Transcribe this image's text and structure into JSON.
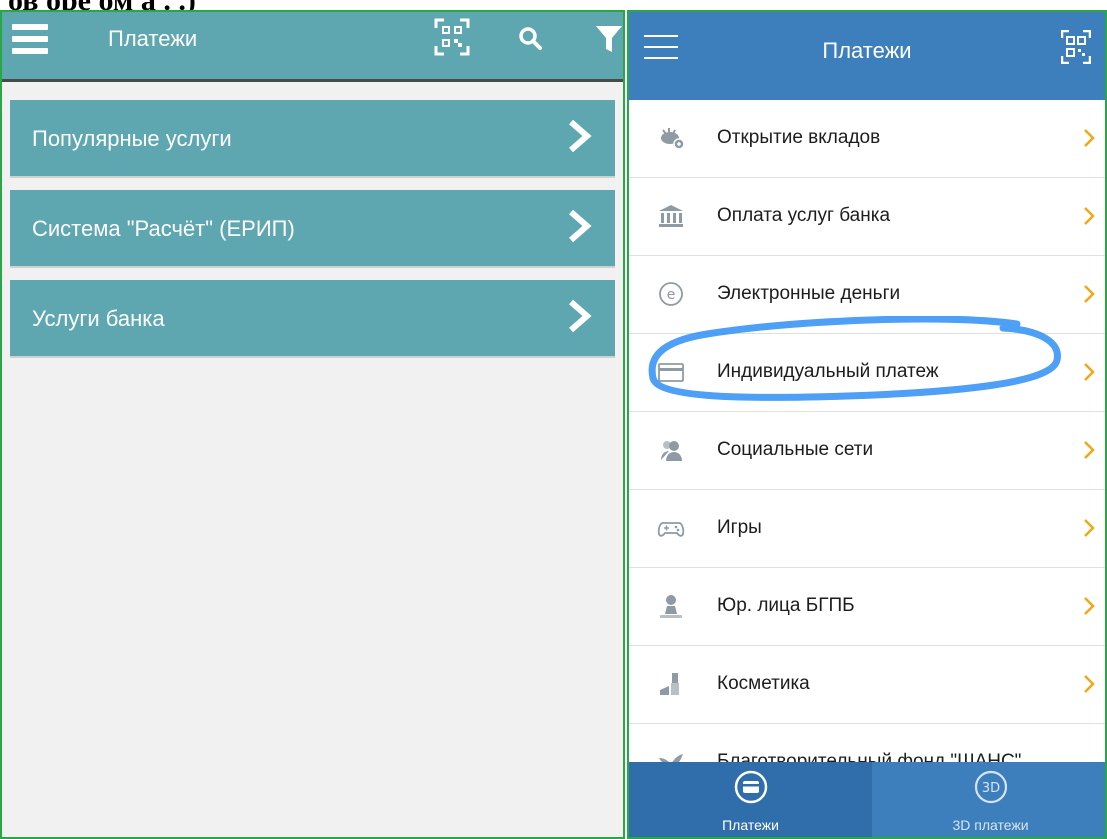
{
  "document": {
    "top_text": "ов оре ом а  . .)"
  },
  "left_app": {
    "title": "Платежи",
    "icons": [
      "qr-code-icon",
      "search-icon",
      "filter-icon"
    ],
    "menu": [
      {
        "label": "Популярные услуги"
      },
      {
        "label": "Система \"Расчёт\" (ЕРИП)"
      },
      {
        "label": "Услуги банка"
      }
    ],
    "colors": {
      "header": "#5ea7b1",
      "background": "#f1f1f1"
    }
  },
  "right_app": {
    "title": "Платежи",
    "items": [
      {
        "label": "Открытие вкладов",
        "icon": "piggy-bank-icon"
      },
      {
        "label": "Оплата услуг банка",
        "icon": "bank-icon"
      },
      {
        "label": "Электронные деньги",
        "icon": "e-money-icon"
      },
      {
        "label": "Индивидуальный платеж",
        "icon": "card-icon"
      },
      {
        "label": "Социальные сети",
        "icon": "people-icon"
      },
      {
        "label": "Игры",
        "icon": "gamepad-icon"
      },
      {
        "label": "Юр. лица БГПБ",
        "icon": "person-icon"
      },
      {
        "label": "Косметика",
        "icon": "cosmetics-icon"
      },
      {
        "label": "Благотворительный фонд \"ШАНС\"",
        "icon": "dove-icon"
      }
    ],
    "tabs": [
      {
        "label": "Платежи",
        "active": true
      },
      {
        "label": "3D платежи",
        "active": false,
        "icon_text": "3D"
      }
    ],
    "colors": {
      "header": "#3d7fbd",
      "chevron": "#f0a818",
      "tab_active": "#2f6eab",
      "tab_inactive": "#3d7fbd",
      "annotation": "#2f8ef5"
    }
  }
}
